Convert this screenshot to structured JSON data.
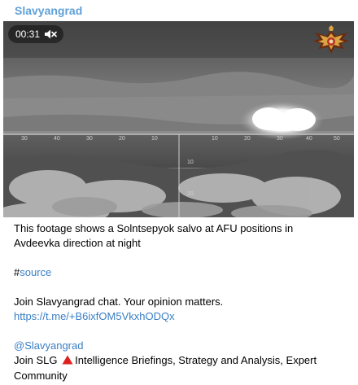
{
  "channel": {
    "name": "Slavyangrad",
    "name_color": "#5fa0d8"
  },
  "video": {
    "duration": "00:31",
    "mute_icon": "mute-icon",
    "emblem_icon": "eagle-emblem-icon",
    "reticle_marks": [
      "30",
      "40",
      "30",
      "20",
      "10",
      "10",
      "20",
      "30",
      "40",
      "50",
      "10",
      "20"
    ]
  },
  "post": {
    "line1": "This footage shows a Solntsepyok salvo at AFU positions in",
    "line2": "Avdeevka direction at night",
    "hashtag_symbol": "#",
    "hashtag_word": "source",
    "chat_invite": "Join Slavyangrad chat. Your opinion matters.",
    "chat_link": "https://t.me/+B6ixfOM5VkxhODQx",
    "mention": "@Slavyangrad",
    "slg_prefix": "Join SLG",
    "slg_icon": "red-triangle-icon",
    "slg_rest_line1": "Intelligence Briefings, Strategy and Analysis, Expert",
    "slg_rest_line2": "Community"
  },
  "colors": {
    "link": "#3a7fc4",
    "warning_triangle": "#e02020"
  }
}
